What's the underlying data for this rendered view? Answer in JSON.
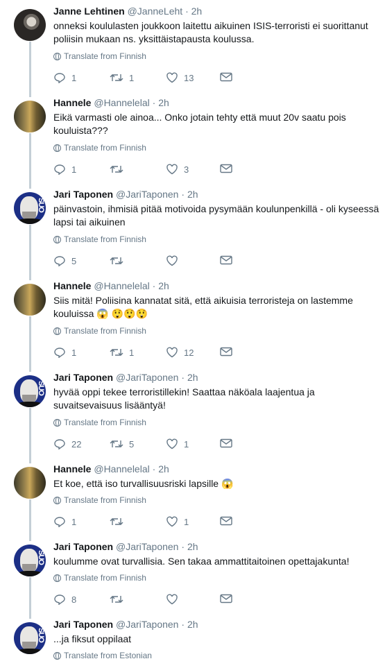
{
  "tweets": [
    {
      "name": "Janne Lehtinen",
      "handle": "@JanneLeht",
      "time": "2h",
      "text": "onneksi koululasten joukkoon laitettu aikuinen ISIS-terroristi ei suorittanut poliisin mukaan ns. yksittäistapausta koulussa.",
      "translate": "Translate from Finnish",
      "replies": "1",
      "retweets": "1",
      "likes": "13"
    },
    {
      "name": "Hannele",
      "handle": "@Hannelelal",
      "time": "2h",
      "text": "Eikä varmasti ole ainoa... Onko jotain tehty että muut 20v saatu pois kouluista???",
      "translate": "Translate from Finnish",
      "replies": "1",
      "retweets": "",
      "likes": "3"
    },
    {
      "name": "Jari Taponen",
      "handle": "@JariTaponen",
      "time": "2h",
      "text": "päinvastoin, ihmisiä pitää motivoida pysymään koulunpenkillä - oli kyseessä lapsi tai aikuinen",
      "translate": "Translate from Finnish",
      "replies": "5",
      "retweets": "",
      "likes": ""
    },
    {
      "name": "Hannele",
      "handle": "@Hannelelal",
      "time": "2h",
      "text": "Siis mitä! Poliisina kannatat sitä, että aikuisia terroristeja on lastemme kouluissa 😱 😲😲😲",
      "translate": "Translate from Finnish",
      "replies": "1",
      "retweets": "1",
      "likes": "12"
    },
    {
      "name": "Jari Taponen",
      "handle": "@JariTaponen",
      "time": "2h",
      "text": "hyvää oppi tekee terroristillekin! Saattaa näköala laajentua ja suvaitsevaisuus lisääntyä!",
      "translate": "Translate from Finnish",
      "replies": "22",
      "retweets": "5",
      "likes": "1"
    },
    {
      "name": "Hannele",
      "handle": "@Hannelelal",
      "time": "2h",
      "text": "Et koe, että iso turvallisuusriski lapsille 😱",
      "translate": "Translate from Finnish",
      "replies": "1",
      "retweets": "",
      "likes": "1"
    },
    {
      "name": "Jari Taponen",
      "handle": "@JariTaponen",
      "time": "2h",
      "text": "koulumme ovat turvallisia. Sen takaa ammattitaitoinen opettajakunta!",
      "translate": "Translate from Finnish",
      "replies": "8",
      "retweets": "",
      "likes": ""
    },
    {
      "name": "Jari Taponen",
      "handle": "@JariTaponen",
      "time": "2h",
      "text": "...ja fiksut oppilaat",
      "translate": "Translate from Estonian"
    }
  ],
  "avatar_text": "SUO",
  "colors": {
    "text": "#14171a",
    "muted": "#657786",
    "thread": "#c4cfd6",
    "avatar_blue": "#1c2f86"
  }
}
